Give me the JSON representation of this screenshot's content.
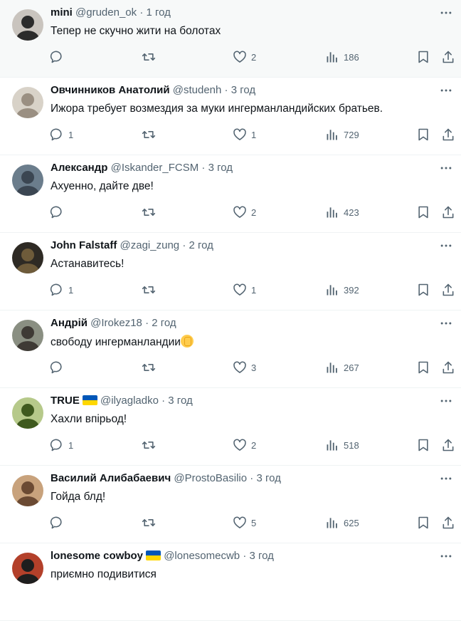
{
  "tweets": [
    {
      "name": "mini",
      "handle": "@gruden_ok",
      "time": "1 год",
      "text": "Тепер не скучно жити на болотах",
      "replies": "",
      "likes": "2",
      "views": "186",
      "flag": false,
      "emoji": false
    },
    {
      "name": "Овчинников Анатолий",
      "handle": "@studenh",
      "time": "3 год",
      "text": "Ижора требует возмездия за муки ингерманландийских братьев.",
      "replies": "1",
      "likes": "1",
      "views": "729",
      "flag": false,
      "emoji": false
    },
    {
      "name": "Александр",
      "handle": "@Iskander_FCSM",
      "time": "3 год",
      "text": "Ахуенно, дайте две!",
      "replies": "",
      "likes": "2",
      "views": "423",
      "flag": false,
      "emoji": false
    },
    {
      "name": "John Falstaff",
      "handle": "@zagi_zung",
      "time": "2 год",
      "text": "Астанавитесь!",
      "replies": "1",
      "likes": "1",
      "views": "392",
      "flag": false,
      "emoji": false
    },
    {
      "name": "Андрій",
      "handle": "@Irokez18",
      "time": "2 год",
      "text": "свободу ингерманландии",
      "replies": "",
      "likes": "3",
      "views": "267",
      "flag": false,
      "emoji": true
    },
    {
      "name": "TRUE",
      "handle": "@ilyagladko",
      "time": "3 год",
      "text": "Хахли впірьод!",
      "replies": "1",
      "likes": "2",
      "views": "518",
      "flag": true,
      "emoji": false
    },
    {
      "name": "Василий Алибабаевич",
      "handle": "@ProstoBasilio",
      "time": "3 год",
      "text": "Гойда блд!",
      "replies": "",
      "likes": "5",
      "views": "625",
      "flag": false,
      "emoji": false
    },
    {
      "name": "lonesome cowboy",
      "handle": "@lonesomecwb",
      "time": "3 год",
      "text": "приємно подивитися",
      "replies": "",
      "likes": "",
      "views": "",
      "flag": true,
      "emoji": false
    }
  ],
  "dot": "·",
  "icons": {
    "more": "more-icon",
    "reply": "reply-icon",
    "retweet": "retweet-icon",
    "like": "like-icon",
    "views": "views-icon",
    "bookmark": "bookmark-icon",
    "share": "share-icon"
  },
  "colors": {
    "muted": "#536471",
    "text": "#0f1419",
    "divider": "#eff3f4",
    "hover": "#f7f9f9",
    "flag_blue": "#0057b7",
    "flag_yellow": "#ffd700"
  }
}
